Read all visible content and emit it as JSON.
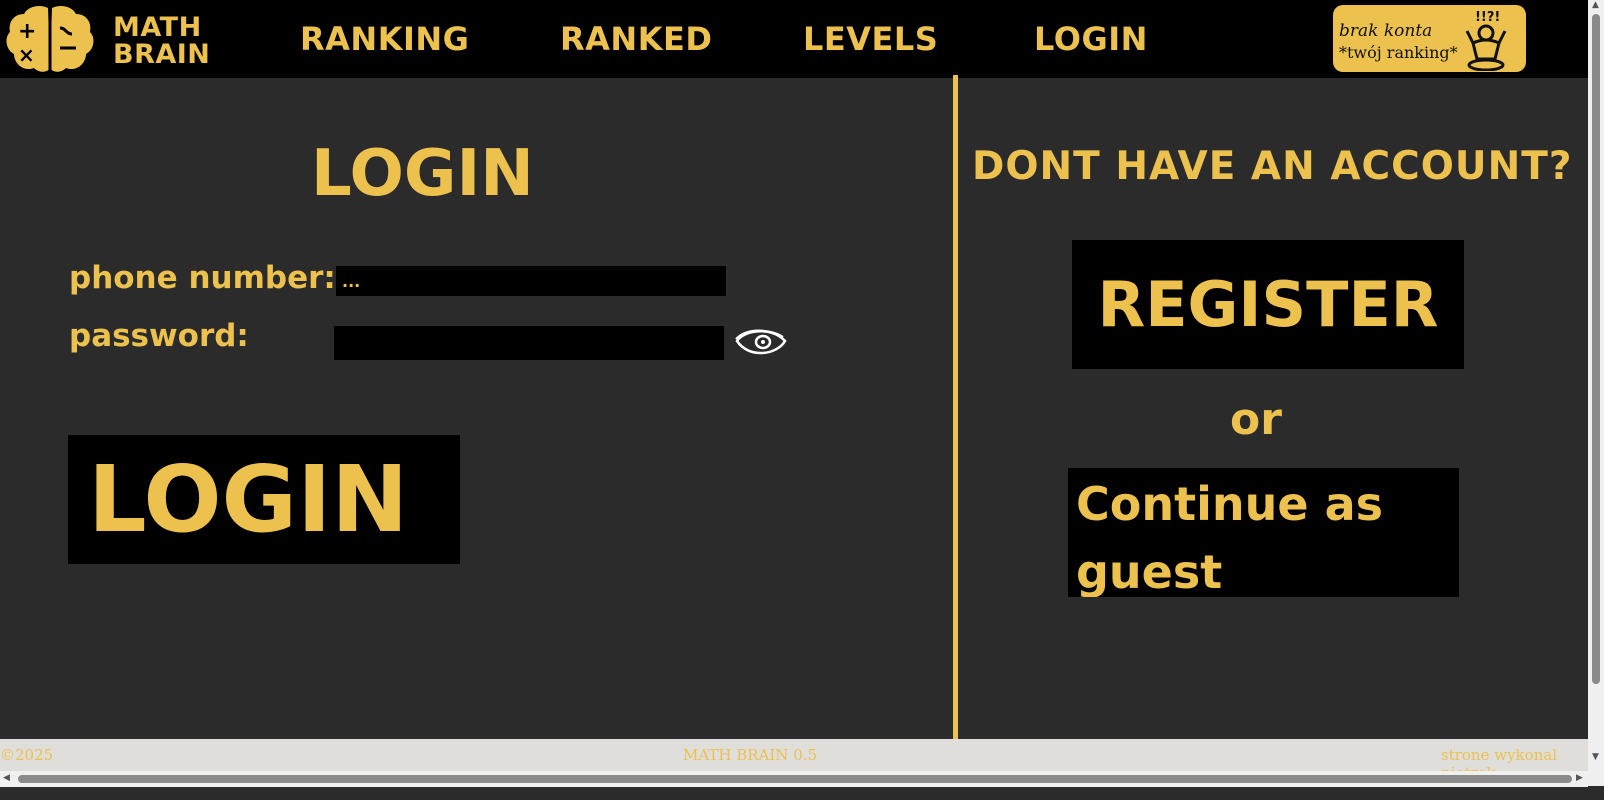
{
  "header": {
    "logo_line1": "MATH",
    "logo_line2": "BRAIN",
    "nav": [
      "RANKING",
      "RANKED",
      "LEVELS",
      "LOGIN"
    ],
    "account_box": {
      "line1": "brak konta",
      "line2": "*twój ranking*"
    }
  },
  "login": {
    "title": "LOGIN",
    "phone_label": "phone number:",
    "phone_value": "...",
    "password_label": "password:",
    "password_value": "",
    "button": "LOGIN"
  },
  "register": {
    "title": "DONT HAVE AN ACCOUNT?",
    "register_button": "REGISTER",
    "or": "or",
    "guest_button": "Continue as guest"
  },
  "footer": {
    "left": "©2025",
    "center": "MATH BRAIN 0.5",
    "right": "strone wykonal piotrek"
  },
  "colors": {
    "accent": "#ecc14e",
    "background": "#2b2b2b",
    "bar": "#000000"
  }
}
